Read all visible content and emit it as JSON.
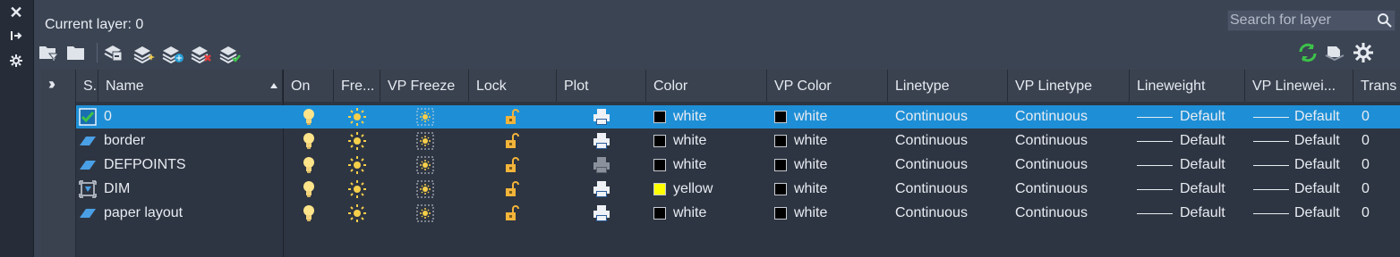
{
  "palette": {
    "window": "#3b4453",
    "grid": "#2e3542",
    "header": "#3a4250",
    "selection": "#1e8fd6",
    "text": "#e6eaf0",
    "refresh": "#3dc24a",
    "bulb": "#ffe48a",
    "sun": "#f6cf4a",
    "lock": "#f2b43a"
  },
  "sidebar": {
    "close_icon": "close-icon",
    "options_icon": "arrow-right-icon",
    "settings_icon": "gear-icon"
  },
  "header": {
    "current_layer": "Current layer: 0",
    "search_placeholder": "Search for layer"
  },
  "toolbar": {
    "left": [
      "new-property-filter-icon",
      "new-group-filter-icon",
      "layer-states-manager-icon",
      "new-layer-icon",
      "new-layer-vp-frozen-icon",
      "delete-layer-icon",
      "set-current-icon"
    ],
    "right": [
      "refresh-icon",
      "settings-icon"
    ]
  },
  "columns": [
    {
      "key": "status",
      "label": "S.."
    },
    {
      "key": "name",
      "label": "Name",
      "sort": "ascending"
    },
    {
      "key": "on",
      "label": "On"
    },
    {
      "key": "freeze",
      "label": "Fre..."
    },
    {
      "key": "vpfreeze",
      "label": "VP Freeze"
    },
    {
      "key": "lock",
      "label": "Lock"
    },
    {
      "key": "plot",
      "label": "Plot"
    },
    {
      "key": "color",
      "label": "Color"
    },
    {
      "key": "vpcolor",
      "label": "VP Color"
    },
    {
      "key": "linetype",
      "label": "Linetype"
    },
    {
      "key": "vplinetype",
      "label": "VP Linetype"
    },
    {
      "key": "lineweight",
      "label": "Lineweight"
    },
    {
      "key": "vplineweight",
      "label": "VP Linewei..."
    },
    {
      "key": "trans",
      "label": "Trans"
    }
  ],
  "layers": [
    {
      "status": "current",
      "name": "0",
      "color": "white",
      "color_hex": "#000000",
      "vp_color": "white",
      "vp_color_hex": "#000000",
      "linetype": "Continuous",
      "vp_linetype": "Continuous",
      "lineweight": "Default",
      "vp_lineweight": "Default",
      "trans": "0",
      "plot_enabled": true,
      "selected": true
    },
    {
      "status": "in-use",
      "name": "border",
      "color": "white",
      "color_hex": "#000000",
      "vp_color": "white",
      "vp_color_hex": "#000000",
      "linetype": "Continuous",
      "vp_linetype": "Continuous",
      "lineweight": "Default",
      "vp_lineweight": "Default",
      "trans": "0",
      "plot_enabled": true,
      "selected": false
    },
    {
      "status": "in-use",
      "name": "DEFPOINTS",
      "color": "white",
      "color_hex": "#000000",
      "vp_color": "white",
      "vp_color_hex": "#000000",
      "linetype": "Continuous",
      "vp_linetype": "Continuous",
      "lineweight": "Default",
      "vp_lineweight": "Default",
      "trans": "0",
      "plot_enabled": false,
      "selected": false
    },
    {
      "status": "dimension",
      "name": "DIM",
      "color": "yellow",
      "color_hex": "#ffff00",
      "vp_color": "white",
      "vp_color_hex": "#000000",
      "linetype": "Continuous",
      "vp_linetype": "Continuous",
      "lineweight": "Default",
      "vp_lineweight": "Default",
      "trans": "0",
      "plot_enabled": true,
      "selected": false
    },
    {
      "status": "in-use",
      "name": "paper layout",
      "color": "white",
      "color_hex": "#000000",
      "vp_color": "white",
      "vp_color_hex": "#000000",
      "linetype": "Continuous",
      "vp_linetype": "Continuous",
      "lineweight": "Default",
      "vp_lineweight": "Default",
      "trans": "0",
      "plot_enabled": true,
      "selected": false
    }
  ]
}
